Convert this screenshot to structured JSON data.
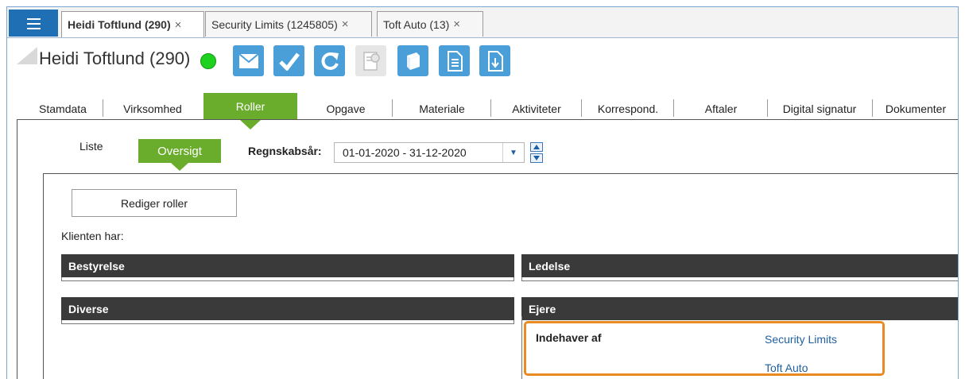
{
  "tabs": [
    {
      "label": "Heidi Toftlund (290)",
      "close": "×",
      "active": true
    },
    {
      "label": "Security Limits (1245805)",
      "close": "×",
      "active": false
    },
    {
      "label": "Toft Auto (13)",
      "close": "×",
      "active": false
    }
  ],
  "header": {
    "client_name": "Heidi Toftlund (290)",
    "status_color": "#1fd11f",
    "toolbar_icons": [
      "mail-icon",
      "check-icon",
      "refresh-icon",
      "certificate-icon",
      "book-icon",
      "document-icon",
      "download-document-icon"
    ]
  },
  "section_tabs": [
    "Stamdata",
    "Virksomhed",
    "Roller",
    "Opgave",
    "Materiale",
    "Aktiviteter",
    "Korrespond.",
    "Aftaler",
    "Digital signatur",
    "Dokumenter"
  ],
  "active_section": "Roller",
  "subtabs": {
    "liste": "Liste",
    "oversigt": "Oversigt"
  },
  "fiscal_year": {
    "label": "Regnskabsår:",
    "value": "01-01-2020 - 31-12-2020"
  },
  "roles": {
    "edit_button": "Rediger roller",
    "client_has": "Klienten har:",
    "groups": {
      "bestyrelse": "Bestyrelse",
      "ledelse": "Ledelse",
      "diverse": "Diverse",
      "ejere": "Ejere"
    },
    "owner_of_label": "Indehaver af",
    "owned_companies": [
      "Security Limits",
      "Toft Auto"
    ]
  },
  "colors": {
    "accent_blue": "#1f6fb4",
    "active_green": "#6aac2c",
    "highlight_orange": "#ea8a22",
    "link_blue": "#1f5f9f"
  }
}
